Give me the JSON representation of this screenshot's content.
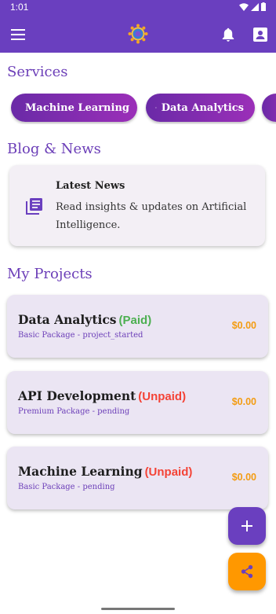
{
  "status_bar": {
    "time": "1:01"
  },
  "app_bar": {
    "color": "#6a3fbf"
  },
  "services": {
    "title": "Services",
    "chips": [
      {
        "label": "Machine Learning"
      },
      {
        "label": "Data Analytics"
      }
    ]
  },
  "blog": {
    "title": "Blog & News",
    "card": {
      "title": "Latest News",
      "text": "Read insights & updates on Artificial Intelligence."
    }
  },
  "projects": {
    "title": "My Projects",
    "items": [
      {
        "name": "Data Analytics",
        "status": "(Paid)",
        "status_color": "#4caf50",
        "subtitle": "Basic Package - project_started",
        "price": "$0.00"
      },
      {
        "name": "API Development",
        "status": "(Unpaid)",
        "status_color": "#f44336",
        "subtitle": "Premium Package - pending",
        "price": "$0.00"
      },
      {
        "name": "Machine Learning",
        "status": "(Unpaid)",
        "status_color": "#f44336",
        "subtitle": "Basic Package - pending",
        "price": "$0.00"
      }
    ]
  },
  "fabs": {
    "add_color": "#6a3fbf",
    "share_color": "#ff9800"
  }
}
